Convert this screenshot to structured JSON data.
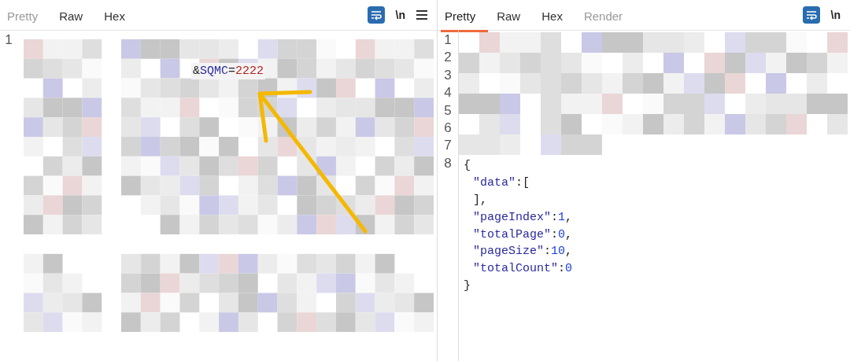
{
  "request_pane": {
    "tabs": [
      {
        "label": "Pretty",
        "selected": false,
        "disabled": true
      },
      {
        "label": "Raw",
        "selected": false,
        "disabled": false
      },
      {
        "label": "Hex",
        "selected": false,
        "disabled": false
      }
    ],
    "wrap_on": true,
    "newline_toggle": "\\n",
    "has_menu": true,
    "line_numbers": [
      "1"
    ],
    "visible_snippet": [
      {
        "kind": "punct",
        "text": "&"
      },
      {
        "kind": "key",
        "text": "SQMC"
      },
      {
        "kind": "punct",
        "text": "="
      },
      {
        "kind": "value",
        "text": "2222"
      }
    ]
  },
  "response_pane": {
    "tabs": [
      {
        "label": "Pretty",
        "selected": true,
        "disabled": false
      },
      {
        "label": "Raw",
        "selected": false,
        "disabled": false
      },
      {
        "label": "Hex",
        "selected": false,
        "disabled": false
      },
      {
        "label": "Render",
        "selected": false,
        "disabled": true
      }
    ],
    "wrap_on": true,
    "newline_toggle": "\\n",
    "line_numbers": [
      "1",
      "2",
      "3",
      "4",
      "5",
      "6",
      "7",
      "8"
    ],
    "body_lines": [
      [
        {
          "kind": "punct",
          "text": "{"
        }
      ],
      [
        {
          "kind": "key",
          "text": "\"data\""
        },
        {
          "kind": "punct",
          "text": ":["
        }
      ],
      [
        {
          "kind": "punct",
          "text": "],"
        }
      ],
      [
        {
          "kind": "key",
          "text": "\"pageIndex\""
        },
        {
          "kind": "punct",
          "text": ":"
        },
        {
          "kind": "number",
          "text": "1"
        },
        {
          "kind": "punct",
          "text": ","
        }
      ],
      [
        {
          "kind": "key",
          "text": "\"totalPage\""
        },
        {
          "kind": "punct",
          "text": ":"
        },
        {
          "kind": "number",
          "text": "0"
        },
        {
          "kind": "punct",
          "text": ","
        }
      ],
      [
        {
          "kind": "key",
          "text": "\"pageSize\""
        },
        {
          "kind": "punct",
          "text": ":"
        },
        {
          "kind": "number",
          "text": "10"
        },
        {
          "kind": "punct",
          "text": ","
        }
      ],
      [
        {
          "kind": "key",
          "text": "\"totalCount\""
        },
        {
          "kind": "punct",
          "text": ":"
        },
        {
          "kind": "number",
          "text": "0"
        }
      ],
      [
        {
          "kind": "punct",
          "text": "}"
        }
      ]
    ]
  }
}
